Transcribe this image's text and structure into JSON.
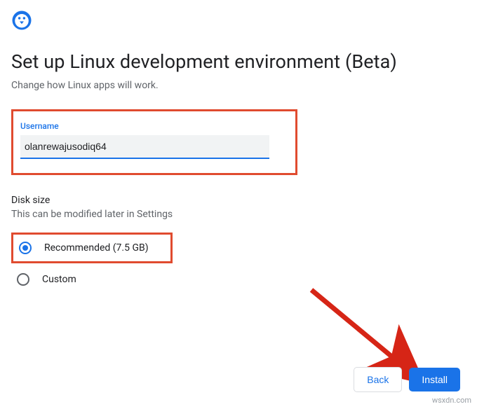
{
  "header": {
    "title": "Set up Linux development environment (Beta)",
    "subtitle": "Change how Linux apps will work."
  },
  "username": {
    "label": "Username",
    "value": "olanrewajusodiq64"
  },
  "disk": {
    "label": "Disk size",
    "help": "This can be modified later in Settings",
    "options": {
      "recommended": "Recommended (7.5 GB)",
      "custom": "Custom"
    }
  },
  "buttons": {
    "back": "Back",
    "install": "Install"
  },
  "watermark": "wsxdn.com",
  "colors": {
    "accent": "#1a73e8",
    "highlight_box": "#e04b2f",
    "arrow": "#d62516"
  }
}
